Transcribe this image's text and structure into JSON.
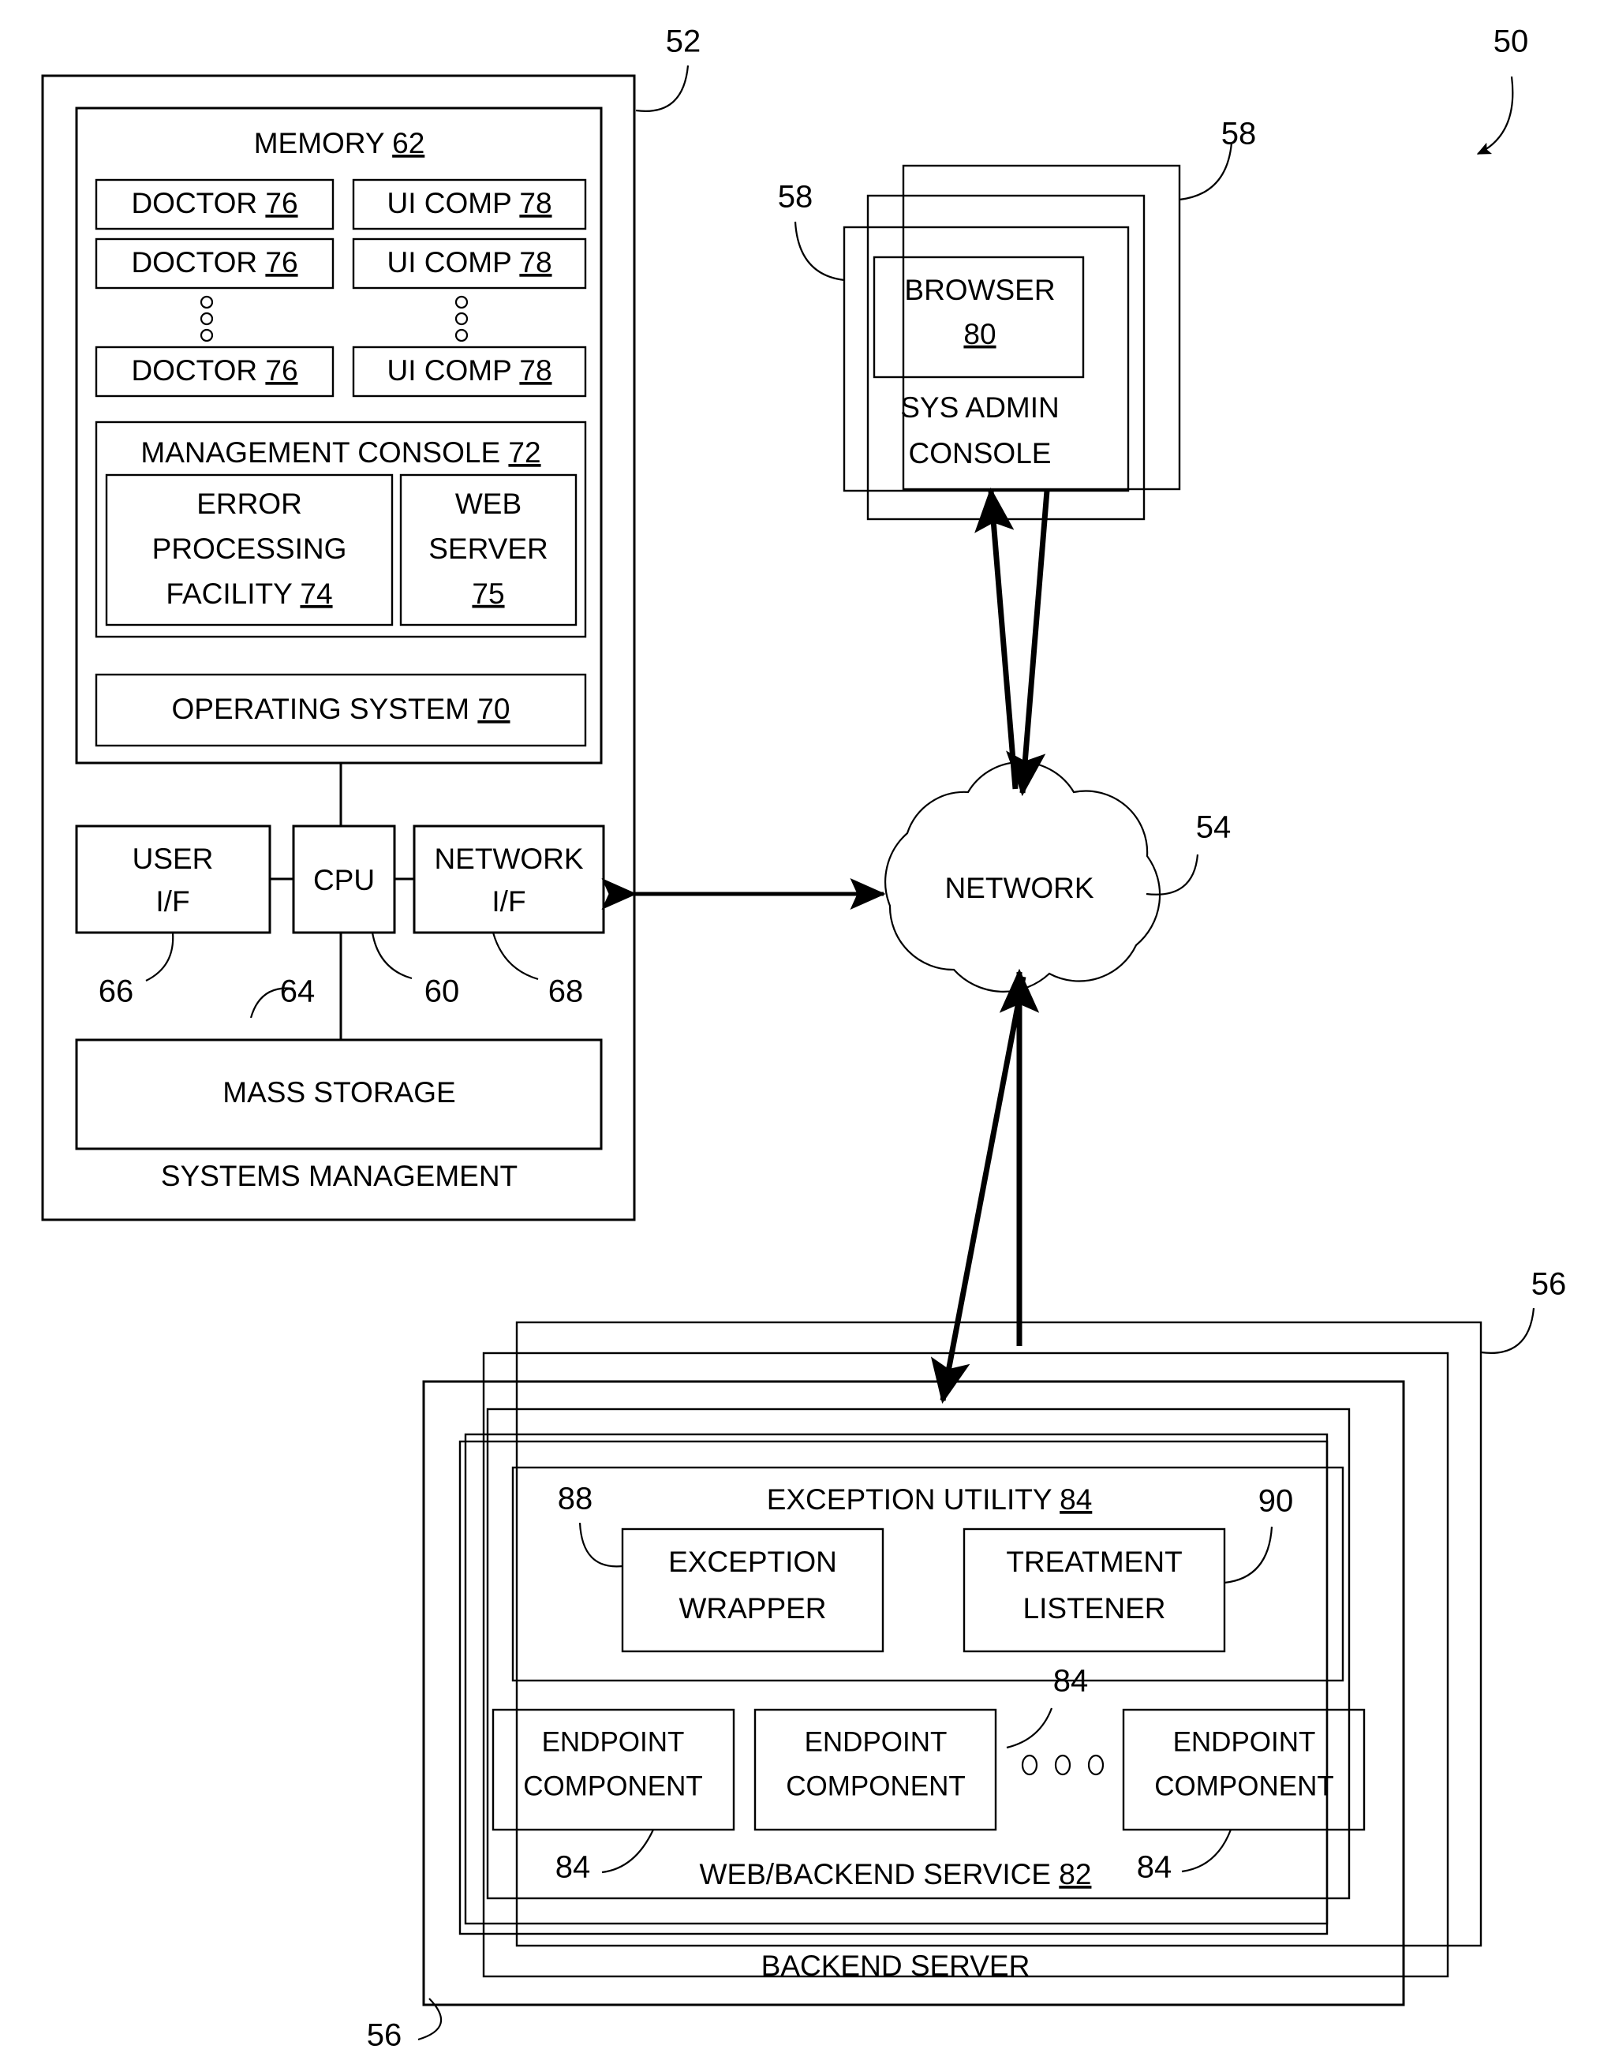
{
  "figure": {
    "type": "patent-block-diagram",
    "overall_ref": "50"
  },
  "refs": {
    "overall": "50",
    "systems_management": "52",
    "network": "54",
    "backend_server": "56",
    "backend_server_bottom": "56",
    "sys_admin_console_left": "58",
    "sys_admin_console_right": "58",
    "network_if": "68",
    "user_if": "66",
    "cpu": "64",
    "bus": "60"
  },
  "systems_management": {
    "label": "SYSTEMS MANAGEMENT",
    "ref": "52",
    "memory": {
      "label": "MEMORY",
      "ref": "62",
      "doctors": [
        {
          "label": "DOCTOR",
          "ref": "76"
        },
        {
          "label": "DOCTOR",
          "ref": "76"
        },
        {
          "label": "DOCTOR",
          "ref": "76"
        }
      ],
      "ui_comps": [
        {
          "label": "UI COMP",
          "ref": "78"
        },
        {
          "label": "UI COMP",
          "ref": "78"
        },
        {
          "label": "UI COMP",
          "ref": "78"
        }
      ],
      "management_console": {
        "label": "MANAGEMENT CONSOLE",
        "ref": "72",
        "error_processing_facility": {
          "line1": "ERROR",
          "line2": "PROCESSING",
          "line3": "FACILITY",
          "ref": "74"
        },
        "web_server": {
          "line1": "WEB",
          "line2": "SERVER",
          "ref": "75"
        }
      },
      "operating_system": {
        "label": "OPERATING SYSTEM",
        "ref": "70"
      }
    },
    "user_if": {
      "line1": "USER",
      "line2": "I/F",
      "ref": "66"
    },
    "cpu": {
      "label": "CPU",
      "ref": "64"
    },
    "network_if": {
      "line1": "NETWORK",
      "line2": "I/F",
      "ref": "68"
    },
    "bus_ref": "60",
    "mass_storage": {
      "label": "MASS STORAGE"
    }
  },
  "sys_admin_console": {
    "browser": {
      "label": "BROWSER",
      "ref": "80"
    },
    "title_line1": "SYS ADMIN",
    "title_line2": "CONSOLE",
    "ref_left": "58",
    "ref_right": "58",
    "stack_count": 3
  },
  "network_cloud": {
    "label": "NETWORK",
    "ref": "54"
  },
  "backend_server": {
    "label": "BACKEND SERVER",
    "ref_top": "56",
    "ref_bottom": "56",
    "stack_count": 3,
    "web_backend_service": {
      "label": "WEB/BACKEND SERVICE",
      "ref": "82"
    },
    "exception_utility": {
      "label": "EXCEPTION UTILITY",
      "ref": "84",
      "exception_wrapper": {
        "line1": "EXCEPTION",
        "line2": "WRAPPER",
        "ref": "88"
      },
      "treatment_listener": {
        "line1": "TREATMENT",
        "line2": "LISTENER",
        "ref": "90"
      }
    },
    "endpoint_components": [
      {
        "line1": "ENDPOINT",
        "line2": "COMPONENT",
        "ref": "84"
      },
      {
        "line1": "ENDPOINT",
        "line2": "COMPONENT",
        "ref": "84"
      },
      {
        "line1": "ENDPOINT",
        "line2": "COMPONENT",
        "ref": "84"
      }
    ],
    "endpoint_mid_ref": "84"
  }
}
